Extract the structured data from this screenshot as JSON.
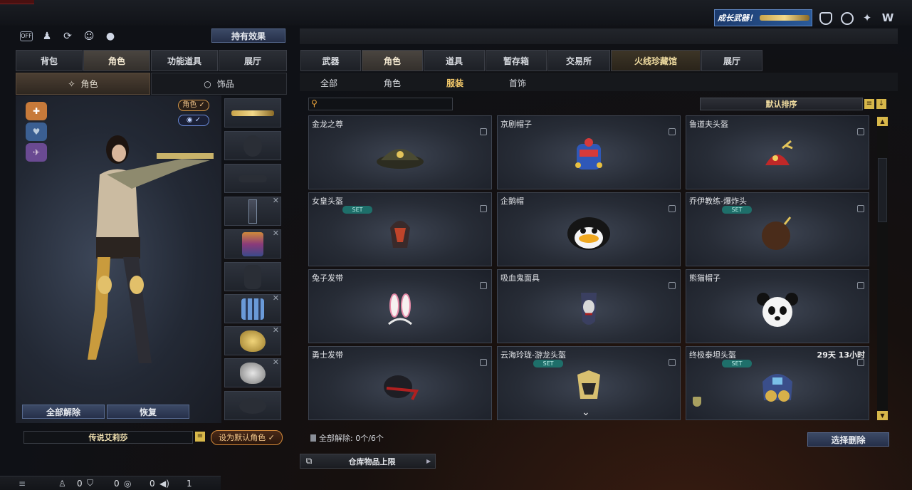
{
  "header": {
    "banner_text": "成长武器！",
    "icons": [
      "shield-icon",
      "globe-icon",
      "wrench-icon",
      "w-logo-icon"
    ]
  },
  "left_panel": {
    "top_icons": [
      "off-toggle-icon",
      "users-icon",
      "refresh-icon",
      "person-icon",
      "penguin-icon"
    ],
    "off_label": "OFF",
    "effect_button": "持有效果",
    "tabs": [
      {
        "label": "背包",
        "active": false
      },
      {
        "label": "角色",
        "active": true
      },
      {
        "label": "功能道具",
        "active": false
      },
      {
        "label": "展厅",
        "active": false
      }
    ],
    "subtabs": [
      {
        "label": "角色",
        "active": true
      },
      {
        "label": "饰品",
        "active": false
      }
    ],
    "badges": {
      "role": "角色 ✓",
      "eye": "✓"
    },
    "slots": [
      {
        "name": "weapon",
        "close": false
      },
      {
        "name": "head",
        "close": false
      },
      {
        "name": "glasses",
        "close": false
      },
      {
        "name": "backpack-small",
        "close": true
      },
      {
        "name": "backpack",
        "close": true
      },
      {
        "name": "body",
        "close": false
      },
      {
        "name": "armor",
        "close": true
      },
      {
        "name": "golden-dragon",
        "close": true
      },
      {
        "name": "silver-dragon",
        "close": true
      },
      {
        "name": "mouth",
        "close": false
      }
    ],
    "unequip_all_button": "全部解除",
    "restore_button": "恢复",
    "character_name": "传说艾莉莎",
    "set_default_button": "设为默认角色 ✓"
  },
  "right_panel": {
    "tabs": [
      {
        "label": "武器",
        "state": "normal"
      },
      {
        "label": "角色",
        "state": "active"
      },
      {
        "label": "道具",
        "state": "normal"
      },
      {
        "label": "暂存箱",
        "state": "normal"
      },
      {
        "label": "交易所",
        "state": "normal"
      },
      {
        "label": "火线珍藏馆",
        "state": "hot"
      },
      {
        "label": "展厅",
        "state": "normal"
      }
    ],
    "subtabs": [
      {
        "label": "全部",
        "active": false
      },
      {
        "label": "角色",
        "active": false
      },
      {
        "label": "服装",
        "active": true
      },
      {
        "label": "首饰",
        "active": false
      }
    ],
    "search": {
      "placeholder": "",
      "value": ""
    },
    "sort_label": "默认排序",
    "items": [
      {
        "name": "金龙之尊",
        "set": false,
        "timer": ""
      },
      {
        "name": "京剧帽子",
        "set": false,
        "timer": ""
      },
      {
        "name": "鲁道夫头盔",
        "set": false,
        "timer": ""
      },
      {
        "name": "女皇头盔",
        "set": true,
        "timer": ""
      },
      {
        "name": "企鹅帽",
        "set": false,
        "timer": ""
      },
      {
        "name": "乔伊教练-爆炸头",
        "set": true,
        "timer": ""
      },
      {
        "name": "兔子发带",
        "set": false,
        "timer": ""
      },
      {
        "name": "吸血鬼面具",
        "set": false,
        "timer": ""
      },
      {
        "name": "熊猫帽子",
        "set": false,
        "timer": ""
      },
      {
        "name": "勇士发带",
        "set": false,
        "timer": ""
      },
      {
        "name": "云海玲珑-游龙头盔",
        "set": true,
        "timer": ""
      },
      {
        "name": "终极泰坦头盔",
        "set": true,
        "timer": "29天 13小时"
      }
    ],
    "set_label": "SET",
    "unequip_info": "全部解除: 0个/6个",
    "select_remove_button": "选择删除",
    "warehouse_limit": "仓库物品上限"
  },
  "status_bar": {
    "counts": [
      "0",
      "0",
      "0",
      "1"
    ]
  }
}
